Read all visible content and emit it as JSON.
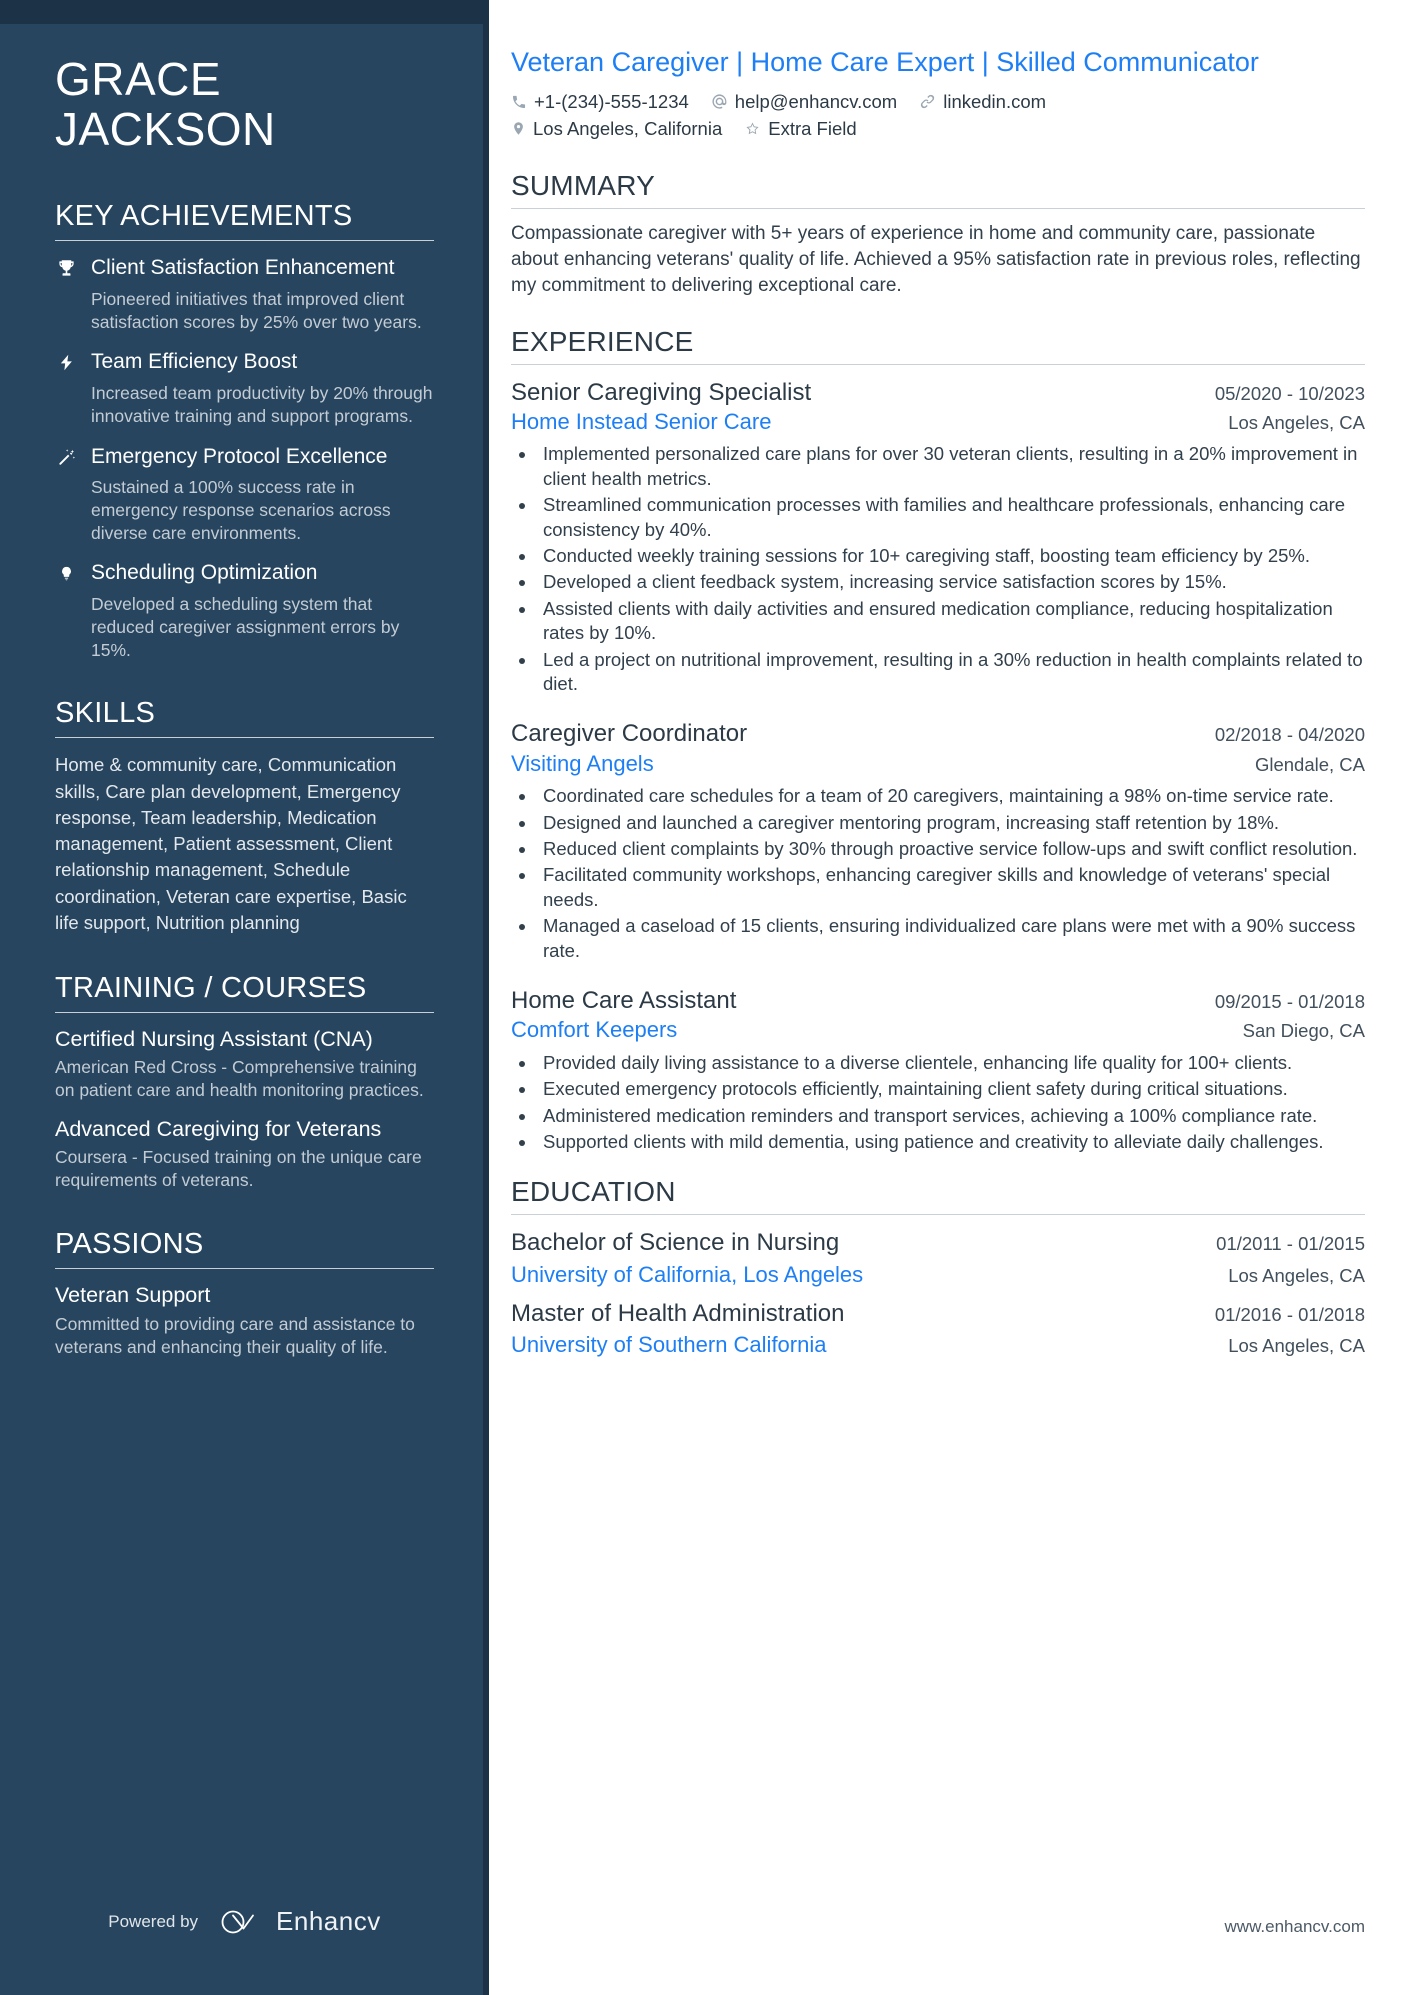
{
  "sidebar": {
    "name_first": "GRACE",
    "name_last": "JACKSON",
    "achievements_heading": "KEY ACHIEVEMENTS",
    "achievements": [
      {
        "icon": "trophy-icon",
        "title": "Client Satisfaction Enhancement",
        "desc": "Pioneered initiatives that improved client satisfaction scores by 25% over two years."
      },
      {
        "icon": "lightning-bolt-icon",
        "title": "Team Efficiency Boost",
        "desc": "Increased team productivity by 20% through innovative training and support programs."
      },
      {
        "icon": "magic-wand-icon",
        "title": "Emergency Protocol Excellence",
        "desc": "Sustained a 100% success rate in emergency response scenarios across diverse care environments."
      },
      {
        "icon": "lightbulb-icon",
        "title": "Scheduling Optimization",
        "desc": "Developed a scheduling system that reduced caregiver assignment errors by 15%."
      }
    ],
    "skills_heading": "SKILLS",
    "skills_text": "Home & community care, Communication skills, Care plan development, Emergency response, Team leadership, Medication management, Patient assessment, Client relationship management, Schedule coordination, Veteran care expertise, Basic life support, Nutrition planning",
    "training_heading": "TRAINING / COURSES",
    "courses": [
      {
        "title": "Certified Nursing Assistant (CNA)",
        "desc": "American Red Cross - Comprehensive training on patient care and health monitoring practices."
      },
      {
        "title": "Advanced Caregiving for Veterans",
        "desc": "Coursera - Focused training on the unique care requirements of veterans."
      }
    ],
    "passions_heading": "PASSIONS",
    "passions": [
      {
        "title": "Veteran Support",
        "desc": "Committed to providing care and assistance to veterans and enhancing their quality of life."
      }
    ],
    "powered_by_label": "Powered by",
    "powered_by_brand": "Enhancv"
  },
  "main": {
    "headline": "Veteran Caregiver | Home Care Expert | Skilled Communicator",
    "contact_row_1": [
      {
        "icon": "phone-icon",
        "text": "+1-(234)-555-1234"
      },
      {
        "icon": "at-sign-icon",
        "text": "help@enhancv.com"
      },
      {
        "icon": "link-icon",
        "text": "linkedin.com"
      }
    ],
    "contact_row_2": [
      {
        "icon": "map-pin-icon",
        "text": "Los Angeles, California"
      },
      {
        "icon": "star-icon",
        "text": "Extra Field"
      }
    ],
    "summary_heading": "SUMMARY",
    "summary_text": "Compassionate caregiver with 5+ years of experience in home and community care, passionate about enhancing veterans' quality of life. Achieved a 95% satisfaction rate in previous roles, reflecting my commitment to delivering exceptional care.",
    "experience_heading": "EXPERIENCE",
    "jobs": [
      {
        "title": "Senior Caregiving Specialist",
        "dates": "05/2020 - 10/2023",
        "company": "Home Instead Senior Care",
        "location": "Los Angeles, CA",
        "bullets": [
          "Implemented personalized care plans for over 30 veteran clients, resulting in a 20% improvement in client health metrics.",
          "Streamlined communication processes with families and healthcare professionals, enhancing care consistency by 40%.",
          "Conducted weekly training sessions for 10+ caregiving staff, boosting team efficiency by 25%.",
          "Developed a client feedback system, increasing service satisfaction scores by 15%.",
          "Assisted clients with daily activities and ensured medication compliance, reducing hospitalization rates by 10%.",
          "Led a project on nutritional improvement, resulting in a 30% reduction in health complaints related to diet."
        ]
      },
      {
        "title": "Caregiver Coordinator",
        "dates": "02/2018 - 04/2020",
        "company": "Visiting Angels",
        "location": "Glendale, CA",
        "bullets": [
          "Coordinated care schedules for a team of 20 caregivers, maintaining a 98% on-time service rate.",
          "Designed and launched a caregiver mentoring program, increasing staff retention by 18%.",
          "Reduced client complaints by 30% through proactive service follow-ups and swift conflict resolution.",
          "Facilitated community workshops, enhancing caregiver skills and knowledge of veterans' special needs.",
          "Managed a caseload of 15 clients, ensuring individualized care plans were met with a 90% success rate."
        ]
      },
      {
        "title": "Home Care Assistant",
        "dates": "09/2015 - 01/2018",
        "company": "Comfort Keepers",
        "location": "San Diego, CA",
        "bullets": [
          "Provided daily living assistance to a diverse clientele, enhancing life quality for 100+ clients.",
          "Executed emergency protocols efficiently, maintaining client safety during critical situations.",
          "Administered medication reminders and transport services, achieving a 100% compliance rate.",
          "Supported clients with mild dementia, using patience and creativity to alleviate daily challenges."
        ]
      }
    ],
    "education_heading": "EDUCATION",
    "education": [
      {
        "degree": "Bachelor of Science in Nursing",
        "dates": "01/2011 - 01/2015",
        "school": "University of California, Los Angeles",
        "location": "Los Angeles, CA"
      },
      {
        "degree": "Master of Health Administration",
        "dates": "01/2016 - 01/2018",
        "school": "University of Southern California",
        "location": "Los Angeles, CA"
      }
    ],
    "site_url": "www.enhancv.com"
  },
  "colors": {
    "sidebar_bg": "#27455f",
    "sidebar_topbar": "#1c3246",
    "accent_blue": "#1e7ff5",
    "body_text": "#32404c"
  }
}
